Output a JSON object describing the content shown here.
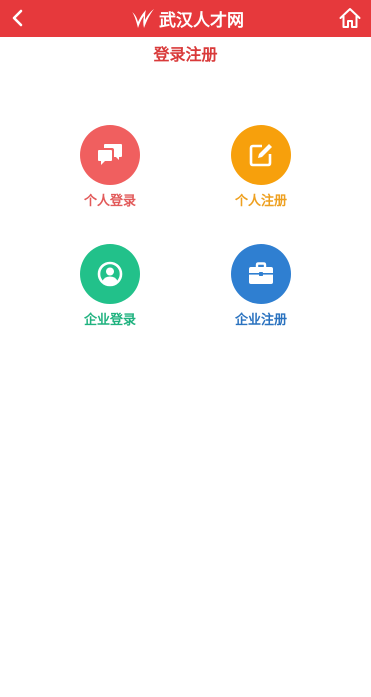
{
  "header": {
    "logo_text": "武汉人才网",
    "back_icon": "chevron-left-icon",
    "home_icon": "home-icon",
    "color": "#e6393c"
  },
  "page": {
    "title": "登录注册"
  },
  "tiles": [
    {
      "label": "个人登录",
      "icon": "chat-bubbles-icon",
      "color": "#f05f5f"
    },
    {
      "label": "个人注册",
      "icon": "edit-icon",
      "color": "#f7a00c"
    },
    {
      "label": "企业登录",
      "icon": "user-circle-icon",
      "color": "#22c18a"
    },
    {
      "label": "企业注册",
      "icon": "briefcase-icon",
      "color": "#2f7fd1"
    }
  ]
}
